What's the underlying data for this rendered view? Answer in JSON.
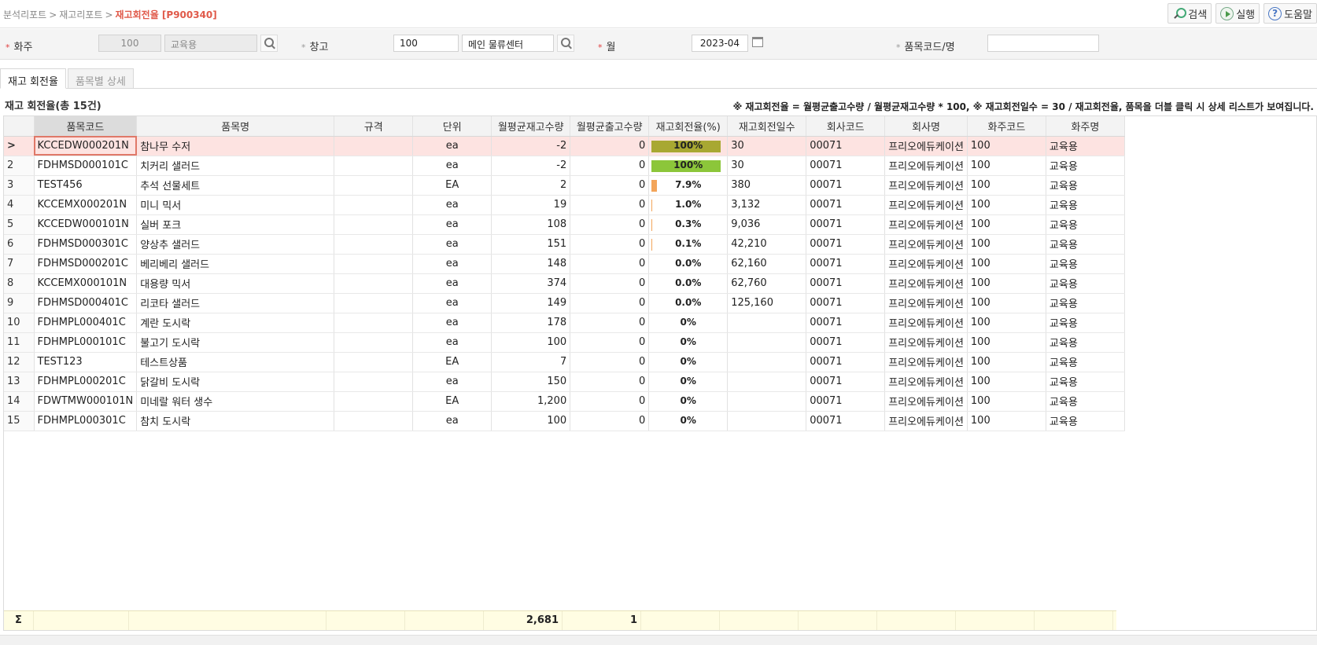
{
  "breadcrumb": {
    "items": [
      "분석리포트",
      "재고리포트"
    ],
    "current": "재고회전율 [P900340]",
    "separator": ">"
  },
  "toolbar": {
    "search_label": "검색",
    "run_label": "실행",
    "help_label": "도움말"
  },
  "filters": {
    "owner": {
      "label": "화주",
      "code": "100",
      "name": "교육용"
    },
    "warehouse": {
      "label": "창고",
      "code": "100",
      "name": "메인 물류센터"
    },
    "month": {
      "label": "월",
      "value": "2023-04"
    },
    "item": {
      "label": "품목코드/명",
      "value": ""
    }
  },
  "tabs": [
    {
      "label": "재고 회전율",
      "active": true
    },
    {
      "label": "품목별 상세",
      "active": false
    }
  ],
  "grid": {
    "title": "재고 회전율(총 15건)",
    "note": "※ 재고회전율 = 월평균출고수량 / 월평균재고수량 * 100, ※ 재고회전일수 = 30 / 재고회전율, 품목을 더블 클릭 시 상세 리스트가 보여집니다.",
    "columns": [
      "품목코드",
      "품목명",
      "규격",
      "단위",
      "월평균재고수량",
      "월평균출고수량",
      "재고회전율(%)",
      "재고회전일수",
      "회사코드",
      "회사명",
      "화주코드",
      "화주명"
    ],
    "selected_marker": ">",
    "rows": [
      {
        "no": "1",
        "code": "KCCEDW000201N",
        "name": "참나무 수저",
        "spec": "",
        "unit": "ea",
        "avg_stock": "-2",
        "avg_out": "0",
        "rate": "100%",
        "rate_pct": 100,
        "bar_color": "#a8a832",
        "days": "30",
        "company_code": "00071",
        "company_name": "프리오에듀케이션",
        "owner_code": "100",
        "owner_name": "교육용"
      },
      {
        "no": "2",
        "code": "FDHMSD000101C",
        "name": "치커리 샐러드",
        "spec": "",
        "unit": "ea",
        "avg_stock": "-2",
        "avg_out": "0",
        "rate": "100%",
        "rate_pct": 100,
        "bar_color": "#8cc63a",
        "days": "30",
        "company_code": "00071",
        "company_name": "프리오에듀케이션",
        "owner_code": "100",
        "owner_name": "교육용"
      },
      {
        "no": "3",
        "code": "TEST456",
        "name": "추석 선물세트",
        "spec": "",
        "unit": "EA",
        "avg_stock": "2",
        "avg_out": "0",
        "rate": "7.9%",
        "rate_pct": 7.9,
        "bar_color": "#f3a55a",
        "days": "380",
        "company_code": "00071",
        "company_name": "프리오에듀케이션",
        "owner_code": "100",
        "owner_name": "교육용"
      },
      {
        "no": "4",
        "code": "KCCEMX000201N",
        "name": "미니 믹서",
        "spec": "",
        "unit": "ea",
        "avg_stock": "19",
        "avg_out": "0",
        "rate": "1.0%",
        "rate_pct": 1.0,
        "bar_color": "#f3a55a",
        "days": "3,132",
        "company_code": "00071",
        "company_name": "프리오에듀케이션",
        "owner_code": "100",
        "owner_name": "교육용"
      },
      {
        "no": "5",
        "code": "KCCEDW000101N",
        "name": "실버 포크",
        "spec": "",
        "unit": "ea",
        "avg_stock": "108",
        "avg_out": "0",
        "rate": "0.3%",
        "rate_pct": 0.3,
        "bar_color": "#f3a55a",
        "days": "9,036",
        "company_code": "00071",
        "company_name": "프리오에듀케이션",
        "owner_code": "100",
        "owner_name": "교육용"
      },
      {
        "no": "6",
        "code": "FDHMSD000301C",
        "name": "양상추 샐러드",
        "spec": "",
        "unit": "ea",
        "avg_stock": "151",
        "avg_out": "0",
        "rate": "0.1%",
        "rate_pct": 0.1,
        "bar_color": "#f3a55a",
        "days": "42,210",
        "company_code": "00071",
        "company_name": "프리오에듀케이션",
        "owner_code": "100",
        "owner_name": "교육용"
      },
      {
        "no": "7",
        "code": "FDHMSD000201C",
        "name": "베리베리 샐러드",
        "spec": "",
        "unit": "ea",
        "avg_stock": "148",
        "avg_out": "0",
        "rate": "0.0%",
        "rate_pct": 0,
        "bar_color": "#f3a55a",
        "days": "62,160",
        "company_code": "00071",
        "company_name": "프리오에듀케이션",
        "owner_code": "100",
        "owner_name": "교육용"
      },
      {
        "no": "8",
        "code": "KCCEMX000101N",
        "name": "대용량 믹서",
        "spec": "",
        "unit": "ea",
        "avg_stock": "374",
        "avg_out": "0",
        "rate": "0.0%",
        "rate_pct": 0,
        "bar_color": "#f3a55a",
        "days": "62,760",
        "company_code": "00071",
        "company_name": "프리오에듀케이션",
        "owner_code": "100",
        "owner_name": "교육용"
      },
      {
        "no": "9",
        "code": "FDHMSD000401C",
        "name": "리코타 샐러드",
        "spec": "",
        "unit": "ea",
        "avg_stock": "149",
        "avg_out": "0",
        "rate": "0.0%",
        "rate_pct": 0,
        "bar_color": "#f3a55a",
        "days": "125,160",
        "company_code": "00071",
        "company_name": "프리오에듀케이션",
        "owner_code": "100",
        "owner_name": "교육용"
      },
      {
        "no": "10",
        "code": "FDHMPL000401C",
        "name": "계란 도시락",
        "spec": "",
        "unit": "ea",
        "avg_stock": "178",
        "avg_out": "0",
        "rate": "0%",
        "rate_pct": 0,
        "bar_color": "#f3a55a",
        "days": "",
        "company_code": "00071",
        "company_name": "프리오에듀케이션",
        "owner_code": "100",
        "owner_name": "교육용"
      },
      {
        "no": "11",
        "code": "FDHMPL000101C",
        "name": "불고기 도시락",
        "spec": "",
        "unit": "ea",
        "avg_stock": "100",
        "avg_out": "0",
        "rate": "0%",
        "rate_pct": 0,
        "bar_color": "#f3a55a",
        "days": "",
        "company_code": "00071",
        "company_name": "프리오에듀케이션",
        "owner_code": "100",
        "owner_name": "교육용"
      },
      {
        "no": "12",
        "code": "TEST123",
        "name": "테스트상품",
        "spec": "",
        "unit": "EA",
        "avg_stock": "7",
        "avg_out": "0",
        "rate": "0%",
        "rate_pct": 0,
        "bar_color": "#f3a55a",
        "days": "",
        "company_code": "00071",
        "company_name": "프리오에듀케이션",
        "owner_code": "100",
        "owner_name": "교육용"
      },
      {
        "no": "13",
        "code": "FDHMPL000201C",
        "name": "닭갈비 도시락",
        "spec": "",
        "unit": "ea",
        "avg_stock": "150",
        "avg_out": "0",
        "rate": "0%",
        "rate_pct": 0,
        "bar_color": "#f3a55a",
        "days": "",
        "company_code": "00071",
        "company_name": "프리오에듀케이션",
        "owner_code": "100",
        "owner_name": "교육용"
      },
      {
        "no": "14",
        "code": "FDWTMW000101N",
        "name": "미네랄 워터 생수",
        "spec": "",
        "unit": "EA",
        "avg_stock": "1,200",
        "avg_out": "0",
        "rate": "0%",
        "rate_pct": 0,
        "bar_color": "#f3a55a",
        "days": "",
        "company_code": "00071",
        "company_name": "프리오에듀케이션",
        "owner_code": "100",
        "owner_name": "교육용"
      },
      {
        "no": "15",
        "code": "FDHMPL000301C",
        "name": "참치 도시락",
        "spec": "",
        "unit": "ea",
        "avg_stock": "100",
        "avg_out": "0",
        "rate": "0%",
        "rate_pct": 0,
        "bar_color": "#f3a55a",
        "days": "",
        "company_code": "00071",
        "company_name": "프리오에듀케이션",
        "owner_code": "100",
        "owner_name": "교육용"
      }
    ],
    "summary": {
      "symbol": "Σ",
      "avg_stock_total": "2,681",
      "avg_out_total": "1"
    }
  }
}
